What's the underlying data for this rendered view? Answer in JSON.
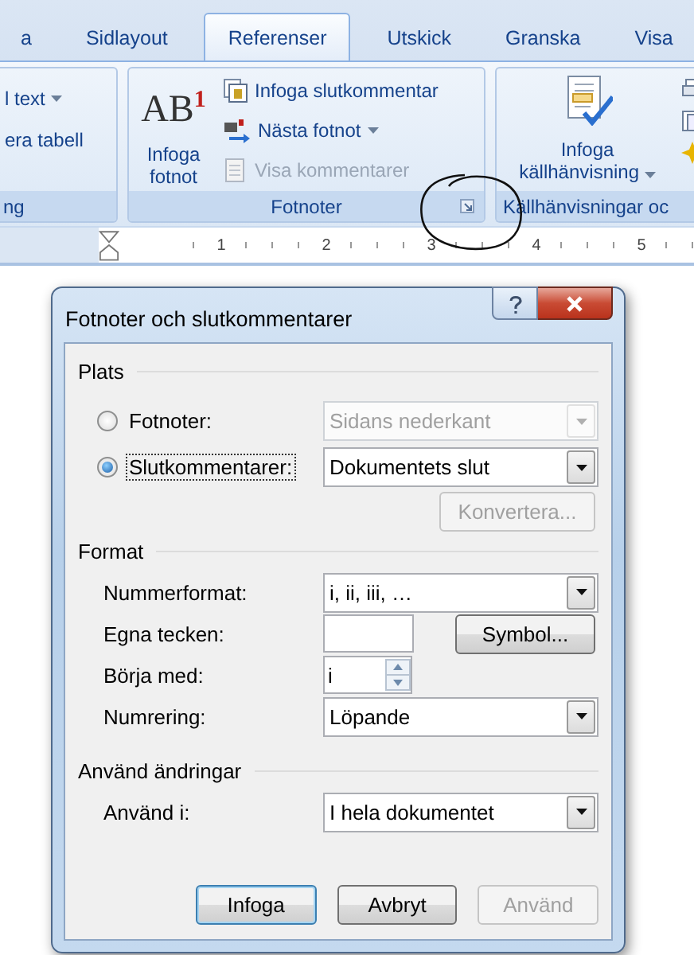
{
  "ribbon": {
    "tabs": [
      {
        "label": "a",
        "selected": false
      },
      {
        "label": "Sidlayout",
        "selected": false
      },
      {
        "label": "Referenser",
        "selected": true
      },
      {
        "label": "Utskick",
        "selected": false
      },
      {
        "label": "Granska",
        "selected": false
      },
      {
        "label": "Visa",
        "selected": false
      }
    ],
    "left_group": {
      "items": [
        {
          "label": "l text",
          "dropdown": true
        },
        {
          "label": "era tabell",
          "dropdown": false
        }
      ],
      "label": "ng"
    },
    "footnotes_group": {
      "large_button": {
        "symbol": "AB$^{1}$",
        "label": "Infoga fotnot"
      },
      "small_buttons": [
        {
          "kind": "endnote",
          "label": "Infoga slutkommentar",
          "dropdown": false,
          "disabled": false
        },
        {
          "kind": "next",
          "label": "Nästa fotnot",
          "dropdown": true,
          "disabled": false
        },
        {
          "kind": "show",
          "label": "Visa kommentarer",
          "dropdown": false,
          "disabled": true
        }
      ],
      "label": "Fotnoter"
    },
    "citations_group": {
      "large_button": {
        "label": "Infoga källhänvisning",
        "dropdown": true
      },
      "label": "Källhänvisningar oc"
    }
  },
  "ruler": {
    "labels": [
      "1",
      "2",
      "3",
      "4",
      "5"
    ]
  },
  "dialog": {
    "title": "Fotnoter och slutkommentarer",
    "location": {
      "heading": "Plats",
      "options": [
        {
          "label": "Fotnoter:",
          "selected": false,
          "focused": false,
          "value": "Sidans nederkant",
          "disabled": true
        },
        {
          "label": "Slutkommentarer:",
          "selected": true,
          "focused": true,
          "value": "Dokumentets slut",
          "disabled": false
        }
      ],
      "convert_button": {
        "label": "Konvertera...",
        "disabled": true
      }
    },
    "format": {
      "heading": "Format",
      "rows": [
        {
          "kind": "dropdown",
          "label": "Nummerformat:",
          "value": "i, ii, iii, …"
        },
        {
          "kind": "text",
          "label": "Egna tecken:",
          "button": "Symbol..."
        },
        {
          "kind": "spinner",
          "label": "Börja med:",
          "value": "i"
        },
        {
          "kind": "dropdown",
          "label": "Numrering:",
          "value": "Löpande"
        }
      ]
    },
    "apply": {
      "heading": "Använd ändringar",
      "rows": [
        {
          "kind": "dropdown",
          "label": "Använd i:",
          "value": "I hela dokumentet"
        }
      ]
    },
    "buttons": [
      {
        "label": "Infoga",
        "default": true,
        "disabled": false
      },
      {
        "label": "Avbryt",
        "default": false,
        "disabled": false
      },
      {
        "label": "Använd",
        "default": false,
        "disabled": true
      }
    ]
  }
}
